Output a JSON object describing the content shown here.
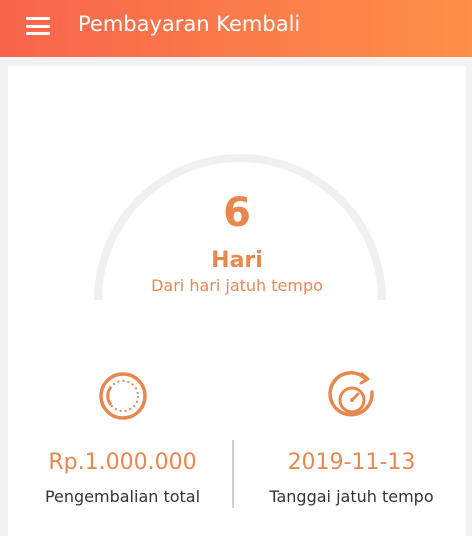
{
  "appbar": {
    "title": "Pembayaran Kembali",
    "menu_icon": "hamburger-menu-icon"
  },
  "countdown": {
    "value": "6",
    "unit": "Hari",
    "caption": "Dari hari jatuh tempo"
  },
  "summary": {
    "total": {
      "icon": "coin-icon",
      "value": "Rp.1.000.000",
      "label": "Pengembalian total"
    },
    "due": {
      "icon": "clock-timer-icon",
      "value": "2019-11-13",
      "label": "Tanggai jatuh tempo"
    }
  },
  "colors": {
    "accent": "#e8884e",
    "appbar_start": "#f7644b",
    "appbar_end": "#fd8f49",
    "gauge_track": "#f0f0f0"
  }
}
